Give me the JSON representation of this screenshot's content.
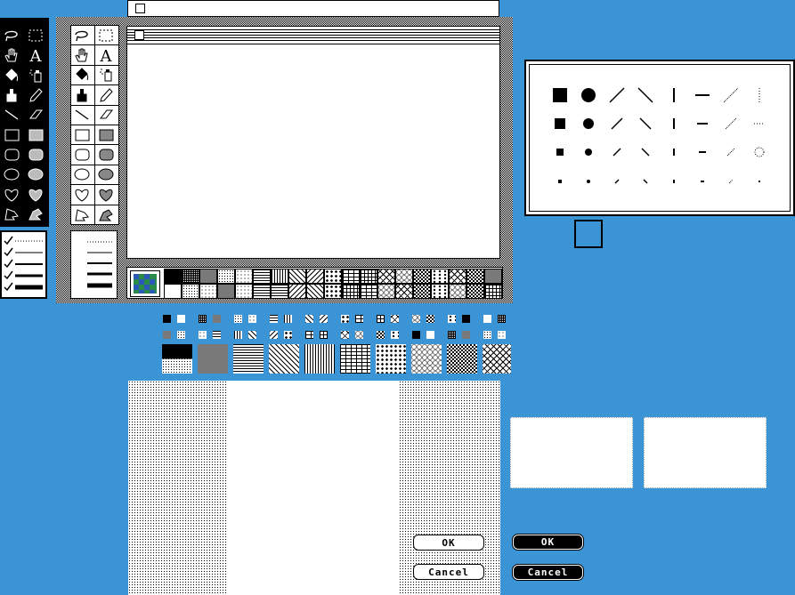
{
  "dialogs": {
    "ok_label": "OK",
    "cancel_label": "Cancel"
  },
  "colors": {
    "desktop": "#3a94d6",
    "selected_pattern_green": "#2a8a4a",
    "selected_pattern_blue": "#2a5ab6"
  },
  "tools": [
    "lasso-icon",
    "marquee-icon",
    "hand-icon",
    "text-icon",
    "paint-bucket-icon",
    "spray-can-icon",
    "brush-icon",
    "pencil-icon",
    "line-icon",
    "eraser-icon",
    "rectangle-icon",
    "filled-rectangle-icon",
    "rounded-rectangle-icon",
    "filled-rounded-rectangle-icon",
    "oval-icon",
    "filled-oval-icon",
    "freeform-icon",
    "filled-freeform-icon",
    "polygon-icon",
    "filled-polygon-icon"
  ],
  "text_tool_glyph": "A"
}
